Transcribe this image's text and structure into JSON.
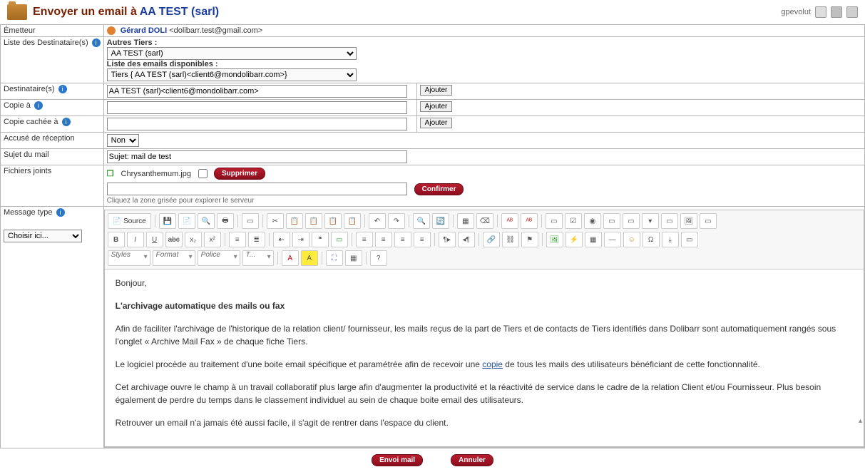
{
  "header": {
    "title_prefix": "Envoyer un email à",
    "title_entity": "AA TEST (sarl)",
    "username": "gpevolut"
  },
  "labels": {
    "emitter": "Émetteur",
    "recipients_list": "Liste des Destinataire(s)",
    "other_tiers": "Autres Tiers :",
    "available_emails": "Liste des emails disponibles :",
    "recipients": "Destinataire(s)",
    "copy_to": "Copie à",
    "bcc": "Copie cachée à",
    "receipt": "Accusé de réception",
    "subject": "Sujet du mail",
    "attachments": "Fichiers joints",
    "message_type": "Message type",
    "add": "Ajouter",
    "delete": "Supprimer",
    "confirm": "Confirmer",
    "hint": "Cliquez la zone grisée pour explorer le serveur",
    "send": "Envoi mail",
    "cancel": "Annuler"
  },
  "values": {
    "emitter_name": "Gérard DOLI",
    "emitter_mail": "<dolibarr.test@gmail.com>",
    "tiers_select": "AA TEST (sarl)",
    "emails_select": "Tiers { AA TEST (sarl)<client6@mondolibarr.com>}",
    "recipients": "AA TEST (sarl)<client6@mondolibarr.com>",
    "copy_to": "",
    "bcc": "",
    "receipt": "Non",
    "subject": "Sujet: mail de test",
    "attachment_name": "Chrysanthemum.jpg",
    "template_select": "Choisir ici..."
  },
  "editor": {
    "source": "Source",
    "styles": "Styles",
    "format": "Format",
    "police": "Police",
    "size": "T...",
    "text_color_a": "A",
    "bg_color_a": "A"
  },
  "body": {
    "greeting": "Bonjour,",
    "h": "L'archivage automatique des mails ou fax",
    "p1a": "Afin de faciliter l'archivage de l'historique de la relation client/ fournisseur, les mails reçus de la part de Tiers et de contacts de Tiers identifiés dans Dolibarr sont  automatiquement rangés sous l'onglet « Archive Mail Fax » de chaque fiche Tiers.",
    "p2a": "Le logiciel procède au traitement d'une boite email spécifique et paramétrée afin de recevoir une ",
    "p2link": "copie",
    "p2b": " de tous les mails des utilisateurs bénéficiant de cette  fonctionnalité.",
    "p3": "Cet archivage ouvre le champ à un travail collaboratif plus large afin d'augmenter la productivité et la réactivité de service dans le cadre de la relation Client  et/ou Fournisseur. Plus besoin également de perdre du temps dans le classement individuel au sein de chaque boite email des utilisateurs.",
    "p4": "Retrouver un email n'a jamais été aussi facile, il s'agit de rentrer dans l'espace du client."
  }
}
